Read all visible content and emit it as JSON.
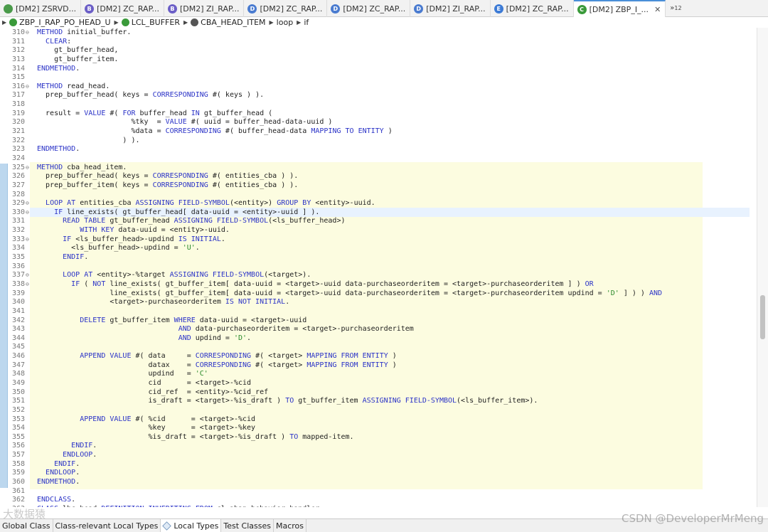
{
  "tabs": [
    {
      "label": "[DM2] ZSRVD...",
      "icon": "service-definition-icon",
      "icon_letter": "",
      "color": "#4a9a4a"
    },
    {
      "label": "[DM2] ZC_RAP...",
      "icon": "behavior-definition-icon",
      "icon_letter": "B",
      "color": "#6c5fc7"
    },
    {
      "label": "[DM2] ZI_RAP...",
      "icon": "behavior-definition-icon",
      "icon_letter": "B",
      "color": "#6c5fc7"
    },
    {
      "label": "[DM2] ZC_RAP...",
      "icon": "data-definition-icon",
      "icon_letter": "D",
      "color": "#4a7bd0"
    },
    {
      "label": "[DM2] ZC_RAP...",
      "icon": "data-definition-icon",
      "icon_letter": "D",
      "color": "#4a7bd0"
    },
    {
      "label": "[DM2] ZI_RAP...",
      "icon": "data-definition-icon",
      "icon_letter": "D",
      "color": "#4a7bd0"
    },
    {
      "label": "[DM2] ZC_RAP...",
      "icon": "metadata-extension-icon",
      "icon_letter": "E",
      "color": "#3d7bd6"
    },
    {
      "label": "[DM2] ZBP_I_...",
      "icon": "class-icon",
      "icon_letter": "C",
      "color": "#3a9a3a",
      "active": true
    }
  ],
  "tab_overflow": "»",
  "tab_overflow_count": "12",
  "tab_close_glyph": "✕",
  "breadcrumb": [
    {
      "label": "ZBP_I_RAP_PO_HEAD_U",
      "color": "#3a9a3a"
    },
    {
      "label": "LCL_BUFFER",
      "color": "#3a9a3a"
    },
    {
      "label": "CBA_HEAD_ITEM",
      "color": "#555555"
    },
    {
      "label": "loop",
      "color": ""
    },
    {
      "label": "if",
      "color": ""
    }
  ],
  "code_lines": [
    {
      "n": "310",
      "fold": "⊖",
      "html": "<span class='kw'>METHOD</span> initial_buffer."
    },
    {
      "n": "311",
      "fold": "",
      "html": "  <span class='kw'>CLEAR</span>:"
    },
    {
      "n": "312",
      "fold": "",
      "html": "    gt_buffer_head,"
    },
    {
      "n": "313",
      "fold": "",
      "html": "    gt_buffer_item."
    },
    {
      "n": "314",
      "fold": "",
      "html": "<span class='kw'>ENDMETHOD</span>."
    },
    {
      "n": "315",
      "fold": "",
      "html": ""
    },
    {
      "n": "316",
      "fold": "⊖",
      "html": "<span class='kw'>METHOD</span> read_head."
    },
    {
      "n": "317",
      "fold": "",
      "html": "  prep_buffer_head( keys = <span class='kw'>CORRESPONDING</span> #( keys ) )."
    },
    {
      "n": "318",
      "fold": "",
      "html": ""
    },
    {
      "n": "319",
      "fold": "",
      "html": "  result = <span class='kw'>VALUE</span> #( <span class='kw'>FOR</span> buffer_head <span class='kw'>IN</span> gt_buffer_head ("
    },
    {
      "n": "320",
      "fold": "",
      "html": "                      %tky  = <span class='kw'>VALUE</span> #( uuid = buffer_head-data-uuid )"
    },
    {
      "n": "321",
      "fold": "",
      "html": "                      %data = <span class='kw'>CORRESPONDING</span> #( buffer_head-data <span class='kw'>MAPPING TO ENTITY</span> )"
    },
    {
      "n": "322",
      "fold": "",
      "html": "                    ) )."
    },
    {
      "n": "323",
      "fold": "",
      "html": "<span class='kw'>ENDMETHOD</span>."
    },
    {
      "n": "324",
      "fold": "",
      "html": ""
    },
    {
      "n": "325",
      "fold": "⊖",
      "html": "<span class='kw'>METHOD</span> cba_head_item."
    },
    {
      "n": "326",
      "fold": "",
      "html": "  prep_buffer_head( keys = <span class='kw'>CORRESPONDING</span> #( entities_cba ) )."
    },
    {
      "n": "327",
      "fold": "",
      "html": "  prep_buffer_item( keys = <span class='kw'>CORRESPONDING</span> #( entities_cba ) )."
    },
    {
      "n": "328",
      "fold": "",
      "html": ""
    },
    {
      "n": "329",
      "fold": "⊖",
      "html": "  <span class='kw'>LOOP AT</span> entities_cba <span class='kw'>ASSIGNING FIELD-SYMBOL</span>(&lt;entity&gt;) <span class='kw'>GROUP BY</span> &lt;entity&gt;-uuid."
    },
    {
      "n": "330",
      "fold": "⊖",
      "html": "    <span class='kw'>IF</span> line_exists( gt_buffer_head[ data-uuid = &lt;entity&gt;-uuid ] )."
    },
    {
      "n": "331",
      "fold": "",
      "html": "      <span class='kw'>READ TABLE</span> gt_buffer_head <span class='kw'>ASSIGNING FIELD-SYMBOL</span>(&lt;ls_buffer_head&gt;)"
    },
    {
      "n": "332",
      "fold": "",
      "html": "          <span class='kw'>WITH KEY</span> data-uuid = &lt;entity&gt;-uuid."
    },
    {
      "n": "333",
      "fold": "⊖",
      "html": "      <span class='kw'>IF</span> &lt;ls_buffer_head&gt;-updind <span class='kw'>IS INITIAL</span>."
    },
    {
      "n": "334",
      "fold": "",
      "html": "        &lt;ls_buffer_head&gt;-updind = <span class='str'>'U'</span>."
    },
    {
      "n": "335",
      "fold": "",
      "html": "      <span class='kw'>ENDIF</span>."
    },
    {
      "n": "336",
      "fold": "",
      "html": ""
    },
    {
      "n": "337",
      "fold": "⊖",
      "html": "      <span class='kw'>LOOP AT</span> &lt;entity&gt;-%target <span class='kw'>ASSIGNING FIELD-SYMBOL</span>(&lt;target&gt;)."
    },
    {
      "n": "338",
      "fold": "⊖",
      "html": "        <span class='kw'>IF</span> ( <span class='kw'>NOT</span> line_exists( gt_buffer_item[ data-uuid = &lt;target&gt;-uuid data-purchaseorderitem = &lt;target&gt;-purchaseorderitem ] ) <span class='kw'>OR</span>"
    },
    {
      "n": "339",
      "fold": "",
      "html": "                 line_exists( gt_buffer_item[ data-uuid = &lt;target&gt;-uuid data-purchaseorderitem = &lt;target&gt;-purchaseorderitem updind = <span class='str'>'D'</span> ] ) ) <span class='kw'>AND</span>"
    },
    {
      "n": "340",
      "fold": "",
      "html": "                 &lt;target&gt;-purchaseorderitem <span class='kw'>IS NOT INITIAL</span>."
    },
    {
      "n": "341",
      "fold": "",
      "html": ""
    },
    {
      "n": "342",
      "fold": "",
      "html": "          <span class='kw'>DELETE</span> gt_buffer_item <span class='kw'>WHERE</span> data-uuid = &lt;target&gt;-uuid"
    },
    {
      "n": "343",
      "fold": "",
      "html": "                                 <span class='kw'>AND</span> data-purchaseorderitem = &lt;target&gt;-purchaseorderitem"
    },
    {
      "n": "344",
      "fold": "",
      "html": "                                 <span class='kw'>AND</span> updind = <span class='str'>'D'</span>."
    },
    {
      "n": "345",
      "fold": "",
      "html": ""
    },
    {
      "n": "346",
      "fold": "",
      "html": "          <span class='kw'>APPEND VALUE</span> #( data     = <span class='kw'>CORRESPONDING</span> #( &lt;target&gt; <span class='kw'>MAPPING FROM ENTITY</span> )"
    },
    {
      "n": "347",
      "fold": "",
      "html": "                          datax    = <span class='kw'>CORRESPONDING</span> #( &lt;target&gt; <span class='kw'>MAPPING FROM ENTITY</span> )"
    },
    {
      "n": "348",
      "fold": "",
      "html": "                          updind   = <span class='str'>'C'</span>"
    },
    {
      "n": "349",
      "fold": "",
      "html": "                          cid      = &lt;target&gt;-%cid"
    },
    {
      "n": "350",
      "fold": "",
      "html": "                          cid_ref  = &lt;entity&gt;-%cid_ref"
    },
    {
      "n": "351",
      "fold": "",
      "html": "                          is_draft = &lt;target&gt;-%is_draft ) <span class='kw'>TO</span> gt_buffer_item <span class='kw'>ASSIGNING FIELD-SYMBOL</span>(&lt;ls_buffer_item&gt;)."
    },
    {
      "n": "352",
      "fold": "",
      "html": ""
    },
    {
      "n": "353",
      "fold": "",
      "html": "          <span class='kw'>APPEND VALUE</span> #( %cid      = &lt;target&gt;-%cid"
    },
    {
      "n": "354",
      "fold": "",
      "html": "                          %key      = &lt;target&gt;-%key"
    },
    {
      "n": "355",
      "fold": "",
      "html": "                          %is_draft = &lt;target&gt;-%is_draft ) <span class='kw'>TO</span> mapped-item."
    },
    {
      "n": "356",
      "fold": "",
      "html": "        <span class='kw'>ENDIF</span>."
    },
    {
      "n": "357",
      "fold": "",
      "html": "      <span class='kw'>ENDLOOP</span>."
    },
    {
      "n": "358",
      "fold": "",
      "html": "    <span class='kw'>ENDIF</span>."
    },
    {
      "n": "359",
      "fold": "",
      "html": "  <span class='kw'>ENDLOOP</span>."
    },
    {
      "n": "360",
      "fold": "",
      "html": "<span class='kw'>ENDMETHOD</span>."
    },
    {
      "n": "361",
      "fold": "",
      "html": ""
    },
    {
      "n": "362",
      "fold": "",
      "html": "<span class='kw'>ENDCLASS</span>."
    },
    {
      "n": "363",
      "fold": "",
      "html": "<span class='kw'>CLASS</span> lhc_head <span class='kw'>DEFINITION INHERITING FROM</span> cl_abap_behavior_handler."
    }
  ],
  "bottom_tabs": [
    {
      "label": "Global Class",
      "active": false
    },
    {
      "label": "Class-relevant Local Types",
      "active": false
    },
    {
      "label": "Local Types",
      "active": true
    },
    {
      "label": "Test Classes",
      "active": false
    },
    {
      "label": "Macros",
      "active": false
    }
  ],
  "watermark": "CSDN @DeveloperMrMeng",
  "watermark_left": "大数据猿"
}
